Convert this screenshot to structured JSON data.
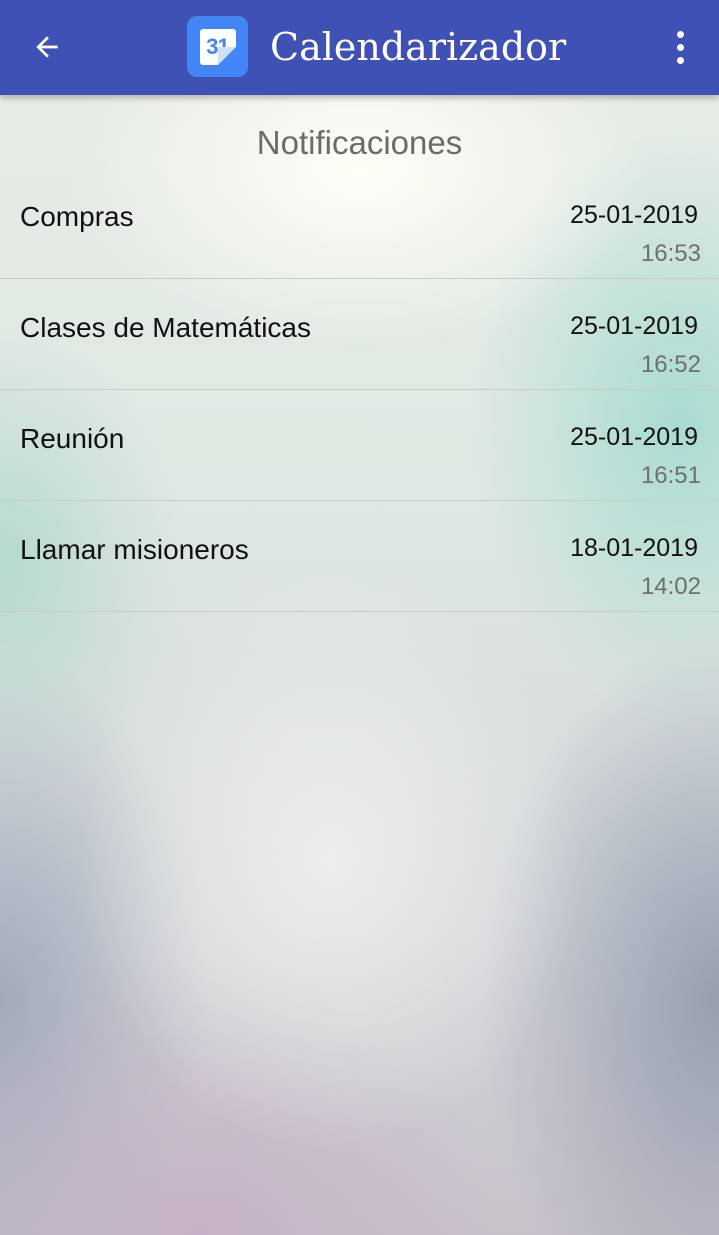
{
  "app_bar": {
    "title": "Calendarizador",
    "app_icon_text": "31",
    "back_icon": "arrow-back-icon",
    "overflow_icon": "more-vert-icon",
    "background_color": "#3f51b5"
  },
  "section": {
    "title": "Notificaciones"
  },
  "notifications": [
    {
      "name": "Compras",
      "date": "25-01-2019",
      "time": "16:53"
    },
    {
      "name": "Clases de Matemáticas",
      "date": "25-01-2019",
      "time": "16:52"
    },
    {
      "name": "Reunión",
      "date": "25-01-2019",
      "time": "16:51"
    },
    {
      "name": "Llamar misioneros",
      "date": "18-01-2019",
      "time": "14:02"
    }
  ]
}
